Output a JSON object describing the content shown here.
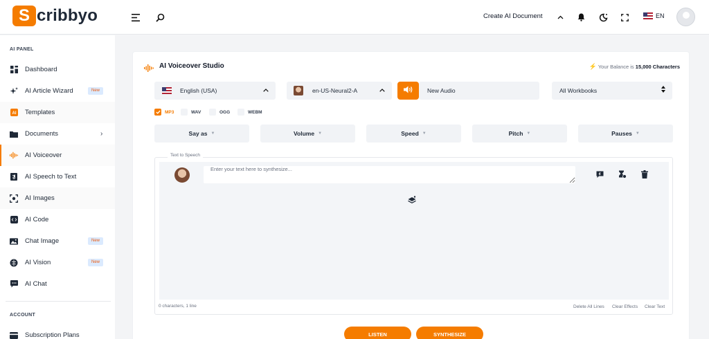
{
  "brand": {
    "logo_letter": "S",
    "logo_rest": "cribbyo",
    "accent": "#f57c00"
  },
  "header": {
    "create_doc": "Create AI Document",
    "lang": "EN"
  },
  "sidebar": {
    "section_panel": "AI PANEL",
    "section_account": "ACCOUNT",
    "items": [
      {
        "label": "Dashboard",
        "icon": "dashboard-icon"
      },
      {
        "label": "AI Article Wizard",
        "icon": "sparkle-icon",
        "badge": "New"
      },
      {
        "label": "Templates",
        "icon": "templates-icon"
      },
      {
        "label": "Documents",
        "icon": "folder-icon"
      },
      {
        "label": "AI Voiceover",
        "icon": "waveform-icon"
      },
      {
        "label": "AI Speech to Text",
        "icon": "audio-file-icon"
      },
      {
        "label": "AI Images",
        "icon": "image-scan-icon"
      },
      {
        "label": "AI Code",
        "icon": "code-icon"
      },
      {
        "label": "Chat Image",
        "icon": "picture-icon",
        "badge": "New"
      },
      {
        "label": "AI Vision",
        "icon": "brain-icon",
        "badge": "New"
      },
      {
        "label": "AI Chat",
        "icon": "chat-icon"
      },
      {
        "label": "Subscription Plans",
        "icon": "plans-icon"
      }
    ]
  },
  "studio": {
    "title": "AI Voiceover Studio",
    "balance_prefix": "Your Balance is",
    "balance_value": "15,000 Characters",
    "language": "English (USA)",
    "voice": "en-US-Neural2-A",
    "audio_name": "New Audio",
    "workbook": "All Workbooks",
    "formats": [
      {
        "label": "MP3",
        "checked": true
      },
      {
        "label": "WAV",
        "checked": false
      },
      {
        "label": "OGG",
        "checked": false
      },
      {
        "label": "WEBM",
        "checked": false
      }
    ],
    "options": [
      "Say as",
      "Volume",
      "Speed",
      "Pitch",
      "Pauses"
    ],
    "tts_legend": "Text to Speech",
    "placeholder": "Enter your text here to synthesize...",
    "counter": "0 characters, 1 line",
    "links": [
      "Delete All Lines",
      "Clear Effects",
      "Clear Text"
    ],
    "listen": "LISTEN",
    "synthesize": "SYNTHESIZE"
  }
}
